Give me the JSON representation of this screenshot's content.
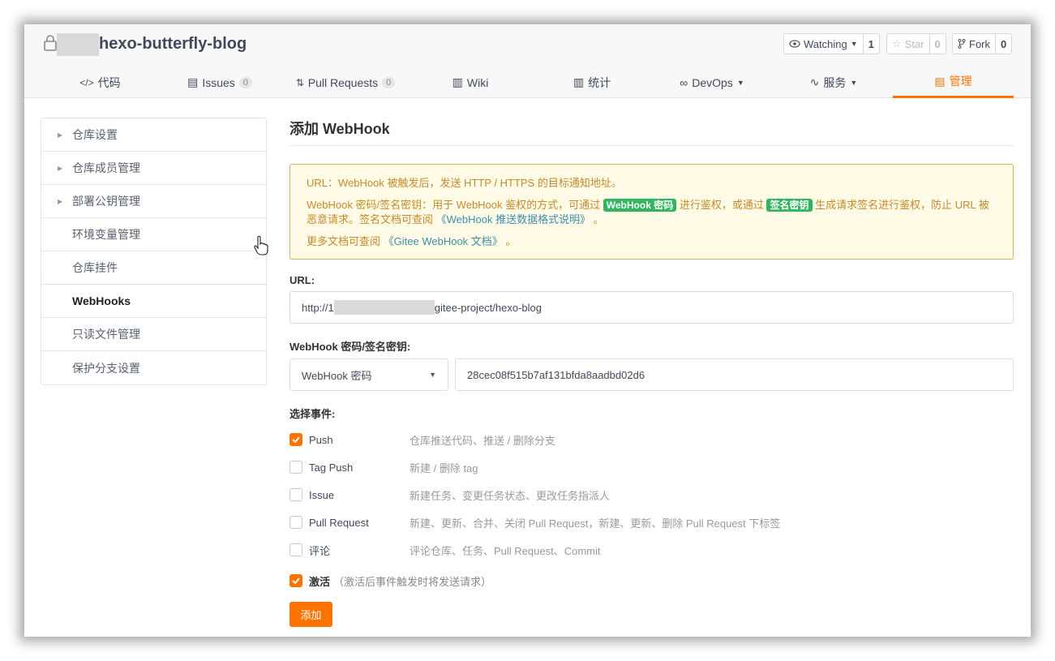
{
  "repo": {
    "name": "hexo-butterfly-blog"
  },
  "header_buttons": {
    "watching": {
      "label": "Watching",
      "count": "1"
    },
    "star": {
      "label": "Star",
      "count": "0"
    },
    "fork": {
      "label": "Fork",
      "count": "0"
    }
  },
  "tabs": [
    {
      "label": "代码"
    },
    {
      "label": "Issues",
      "badge": "0"
    },
    {
      "label": "Pull Requests",
      "badge": "0"
    },
    {
      "label": "Wiki"
    },
    {
      "label": "统计"
    },
    {
      "label": "DevOps"
    },
    {
      "label": "服务"
    },
    {
      "label": "管理"
    }
  ],
  "sidebar": {
    "items": [
      {
        "label": "仓库设置"
      },
      {
        "label": "仓库成员管理"
      },
      {
        "label": "部署公钥管理"
      },
      {
        "label": "环境变量管理"
      },
      {
        "label": "仓库挂件"
      },
      {
        "label": "WebHooks"
      },
      {
        "label": "只读文件管理"
      },
      {
        "label": "保护分支设置"
      }
    ]
  },
  "main": {
    "title": "添加 WebHook",
    "notice": {
      "line1": "URL：WebHook 被触发后，发送 HTTP / HTTPS 的目标通知地址。",
      "line2_a": "WebHook 密码/签名密钥：用于 WebHook 鉴权的方式，可通过",
      "tag1": "WebHook 密码",
      "line2_b": "进行鉴权，或通过",
      "tag2": "签名密钥",
      "line2_c": "生成请求签名进行鉴权，防止 URL 被恶意请求。签名文档可查阅",
      "link1": "《WebHook 推送数据格式说明》",
      "line2_d": "。",
      "line3_a": "更多文档可查阅",
      "link2": "《Gitee WebHook 文档》",
      "line3_b": "。"
    },
    "url_label": "URL:",
    "url_prefix": "http://1",
    "url_suffix": "gitee-project/hexo-blog",
    "secret_label": "WebHook 密码/签名密钥:",
    "secret_type": "WebHook 密码",
    "secret_value": "28cec08f515b7af131bfda8aadbd02d6",
    "events_label": "选择事件:",
    "events": [
      {
        "name": "Push",
        "desc": "仓库推送代码、推送 / 删除分支",
        "checked": true
      },
      {
        "name": "Tag Push",
        "desc": "新建 / 删除 tag",
        "checked": false
      },
      {
        "name": "Issue",
        "desc": "新建任务、变更任务状态、更改任务指派人",
        "checked": false
      },
      {
        "name": "Pull Request",
        "desc": "新建、更新、合并、关闭 Pull Request，新建、更新、删除 Pull Request 下标签",
        "checked": false
      },
      {
        "name": "评论",
        "desc": "评论仓库、任务、Pull Request、Commit",
        "checked": false
      }
    ],
    "activate": {
      "name": "激活",
      "desc": "（激活后事件触发时将发送请求）",
      "checked": true
    },
    "submit_label": "添加"
  },
  "colors": {
    "accent": "#fe7300",
    "tag_green": "#32b55f",
    "notice_text": "#c6892b"
  }
}
